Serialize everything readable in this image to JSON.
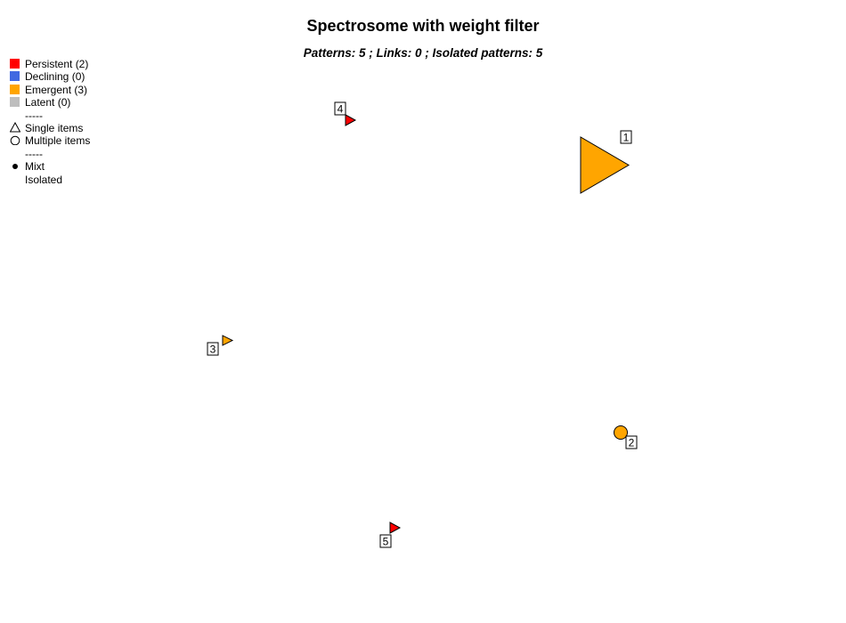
{
  "title": "Spectrosome with weight filter",
  "subtitle": "Patterns: 5 ; Links: 0 ; Isolated patterns: 5",
  "legend": {
    "status": [
      {
        "label": "Persistent (2)",
        "color": "#ff0000"
      },
      {
        "label": "Declining (0)",
        "color": "#4169e1"
      },
      {
        "label": "Emergent (3)",
        "color": "#ffa500"
      },
      {
        "label": "Latent (0)",
        "color": "#bebebe"
      }
    ],
    "separator1": "-----",
    "shapes": [
      {
        "label": "Single items",
        "icon": "triangle-icon"
      },
      {
        "label": "Multiple items",
        "icon": "circle-icon"
      }
    ],
    "separator2": "-----",
    "links": [
      {
        "label": "Mixt",
        "icon": "dot-icon"
      },
      {
        "label": "Isolated",
        "icon": ""
      }
    ]
  },
  "nodes": [
    {
      "id": "1",
      "shape": "triangle",
      "status": "Emergent",
      "color": "#ffa500"
    },
    {
      "id": "2",
      "shape": "circle",
      "status": "Emergent",
      "color": "#ffa500"
    },
    {
      "id": "3",
      "shape": "triangle",
      "status": "Emergent",
      "color": "#ffa500"
    },
    {
      "id": "4",
      "shape": "triangle",
      "status": "Persistent",
      "color": "#ff0000"
    },
    {
      "id": "5",
      "shape": "triangle",
      "status": "Persistent",
      "color": "#ff0000"
    }
  ]
}
